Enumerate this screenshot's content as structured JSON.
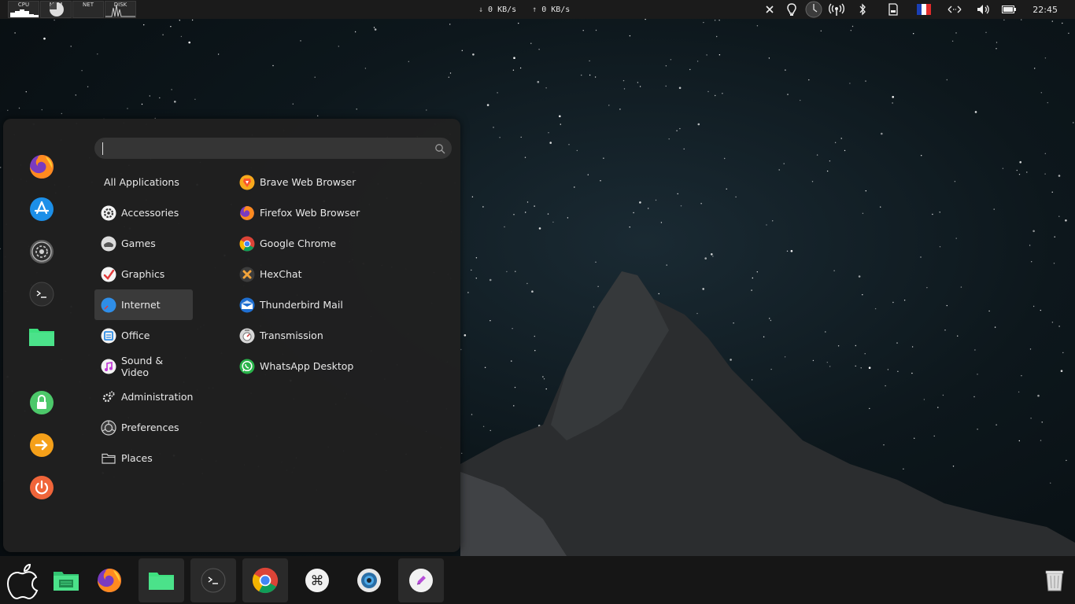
{
  "top_panel": {
    "sysmon": [
      {
        "label": "CPU"
      },
      {
        "label": "MEM"
      },
      {
        "label": "NET"
      },
      {
        "label": "DISK"
      }
    ],
    "net_down": "0 KB/s",
    "net_up": "0 KB/s",
    "clock": "22:45",
    "tray_icons": [
      "close-icon",
      "location-pin-icon",
      "clock-icon",
      "wireless-broadcast-icon",
      "bluetooth-icon",
      "sd-card-icon",
      "france-flag-icon",
      "network-arrows-icon",
      "volume-icon",
      "battery-icon"
    ]
  },
  "menu": {
    "search": {
      "value": "",
      "placeholder": ""
    },
    "favorites": [
      "firefox-icon",
      "app-store-icon",
      "system-settings-icon",
      "terminal-icon",
      "files-folder-icon",
      "lock-screen-icon",
      "logout-icon",
      "power-icon"
    ],
    "categories": [
      {
        "label": "All Applications",
        "icon": ""
      },
      {
        "label": "Accessories",
        "icon": "accessories-icon"
      },
      {
        "label": "Games",
        "icon": "games-icon"
      },
      {
        "label": "Graphics",
        "icon": "graphics-icon"
      },
      {
        "label": "Internet",
        "icon": "internet-icon",
        "active": true
      },
      {
        "label": "Office",
        "icon": "office-icon"
      },
      {
        "label": "Sound & Video",
        "icon": "sound-video-icon"
      },
      {
        "label": "Administration",
        "icon": "administration-icon"
      },
      {
        "label": "Preferences",
        "icon": "preferences-icon"
      },
      {
        "label": "Places",
        "icon": "places-folder-icon"
      }
    ],
    "apps": [
      {
        "label": "Brave Web Browser",
        "icon": "brave-icon"
      },
      {
        "label": "Firefox Web Browser",
        "icon": "firefox-icon"
      },
      {
        "label": "Google Chrome",
        "icon": "chrome-icon"
      },
      {
        "label": "HexChat",
        "icon": "hexchat-icon"
      },
      {
        "label": "Thunderbird Mail",
        "icon": "thunderbird-icon"
      },
      {
        "label": "Transmission",
        "icon": "transmission-icon"
      },
      {
        "label": "WhatsApp Desktop",
        "icon": "whatsapp-icon"
      }
    ]
  },
  "dock": {
    "items": [
      "apple-menu-icon",
      "file-manager-icon",
      "firefox-icon",
      "files-folder-icon",
      "terminal-icon",
      "chrome-icon",
      "keyboard-command-icon",
      "system-monitor-icon",
      "text-editor-icon",
      "trash-icon"
    ]
  },
  "colors": {
    "accent_green": "#4be28a",
    "menu_bg": "#202020",
    "panel_bg": "#1b1b1b"
  }
}
